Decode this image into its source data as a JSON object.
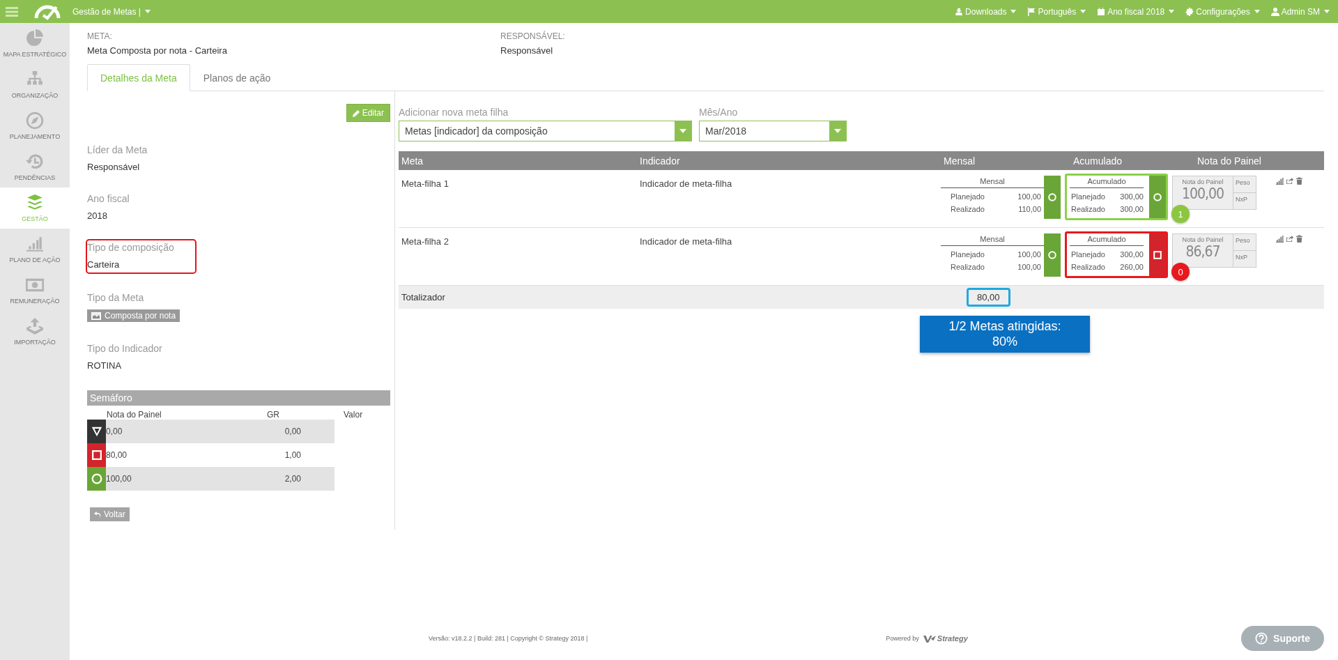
{
  "topbar": {
    "title": "Gestão de Metas |",
    "menus": [
      {
        "label": "Downloads",
        "kind": "download"
      },
      {
        "label": "Português",
        "kind": "flag"
      },
      {
        "label": "Ano fiscal 2018",
        "kind": "calendar"
      },
      {
        "label": "Configurações",
        "kind": "gear"
      },
      {
        "label": "Admin SM",
        "kind": "user"
      }
    ]
  },
  "sidebar": {
    "items": [
      {
        "label": "MAPA ESTRATÉGICO",
        "kind": "pie",
        "selected": false
      },
      {
        "label": "ORGANIZAÇÃO",
        "kind": "org",
        "selected": false
      },
      {
        "label": "PLANEJAMENTO",
        "kind": "compass",
        "selected": false
      },
      {
        "label": "PENDÊNCIAS",
        "kind": "history",
        "selected": false
      },
      {
        "label": "GESTÃO",
        "kind": "layers",
        "selected": true
      },
      {
        "label": "PLANO DE AÇÃO",
        "kind": "bars",
        "selected": false
      },
      {
        "label": "REMUNERAÇÃO",
        "kind": "money",
        "selected": false
      },
      {
        "label": "IMPORTAÇÃO",
        "kind": "upload",
        "selected": false
      }
    ]
  },
  "header": {
    "meta_label": "META:",
    "meta_value": "Meta Composta por nota - Carteira",
    "resp_label": "RESPONSÁVEL:",
    "resp_value": "Responsável"
  },
  "tabs": [
    {
      "label": "Detalhes da Meta",
      "selected": true
    },
    {
      "label": "Planos de ação",
      "selected": false
    }
  ],
  "edit_button": "Editar",
  "fields": [
    {
      "label": "Líder da Meta",
      "value": "Responsável",
      "kind": "text",
      "highlighted": false
    },
    {
      "label": "Ano fiscal",
      "value": "2018",
      "kind": "text",
      "highlighted": false
    },
    {
      "label": "Tipo de composição",
      "value": "Carteira",
      "kind": "text",
      "highlighted": true
    },
    {
      "label": "Tipo da Meta",
      "value": "Composta por nota",
      "kind": "tag",
      "highlighted": false
    },
    {
      "label": "Tipo do Indicador",
      "value": "ROTINA",
      "kind": "text",
      "highlighted": false
    }
  ],
  "semaforo": {
    "title": "Semáforo",
    "columns": [
      "Nota do Painel",
      "GR",
      "Valor"
    ],
    "rows": [
      {
        "kind": "triangle",
        "nota": "0,00",
        "gr": "0,00"
      },
      {
        "kind": "square",
        "nota": "80,00",
        "gr": "1,00"
      },
      {
        "kind": "circle",
        "nota": "100,00",
        "gr": "2,00"
      }
    ]
  },
  "back_button": "Voltar",
  "add_child": {
    "label": "Adicionar nova meta filha",
    "value": "Metas [indicador] da composição"
  },
  "month": {
    "label": "Mês/Ano",
    "value": "Mar/2018"
  },
  "table": {
    "columns": [
      "Meta",
      "Indicador",
      "Mensal",
      "Acumulado",
      "Nota do Painel"
    ],
    "rows": [
      {
        "meta": "Meta-filha 1",
        "indicador": "Indicador de meta-filha",
        "mensal": {
          "header": "Mensal",
          "planejado_label": "Planejado",
          "planejado": "100,00",
          "realizado_label": "Realizado",
          "realizado": "110,00",
          "kind": "circle"
        },
        "acumulado": {
          "header": "Acumulado",
          "planejado_label": "Planejado",
          "planejado": "300,00",
          "realizado_label": "Realizado",
          "realizado": "300,00",
          "kind": "circle",
          "color": "#8cd04a"
        },
        "nota": {
          "label": "Nota do Painel",
          "value": "100,00",
          "peso": "Peso",
          "nxp": "NxP"
        },
        "badge": {
          "text": "1",
          "color": "#8cc63f"
        }
      },
      {
        "meta": "Meta-filha 2",
        "indicador": "Indicador de meta-filha",
        "mensal": {
          "header": "Mensal",
          "planejado_label": "Planejado",
          "planejado": "100,00",
          "realizado_label": "Realizado",
          "realizado": "100,00",
          "kind": "circle"
        },
        "acumulado": {
          "header": "Acumulado",
          "planejado_label": "Planejado",
          "planejado": "300,00",
          "realizado_label": "Realizado",
          "realizado": "260,00",
          "kind": "square",
          "color": "#e8191e"
        },
        "nota": {
          "label": "Nota do Painel",
          "value": "86,67",
          "peso": "Peso",
          "nxp": "NxP"
        },
        "badge": {
          "text": "0",
          "color": "#e8191e"
        }
      }
    ],
    "total": {
      "label": "Totalizador",
      "value": "80,00"
    }
  },
  "callout": "1/2 Metas atingidas: 80%",
  "footer": {
    "version": "Versão: v18.2.2 | Build: 281 | Copyright © Strategy 2018 |",
    "powered": "Powered by",
    "brand": "Strategy",
    "support": "Suporte"
  }
}
